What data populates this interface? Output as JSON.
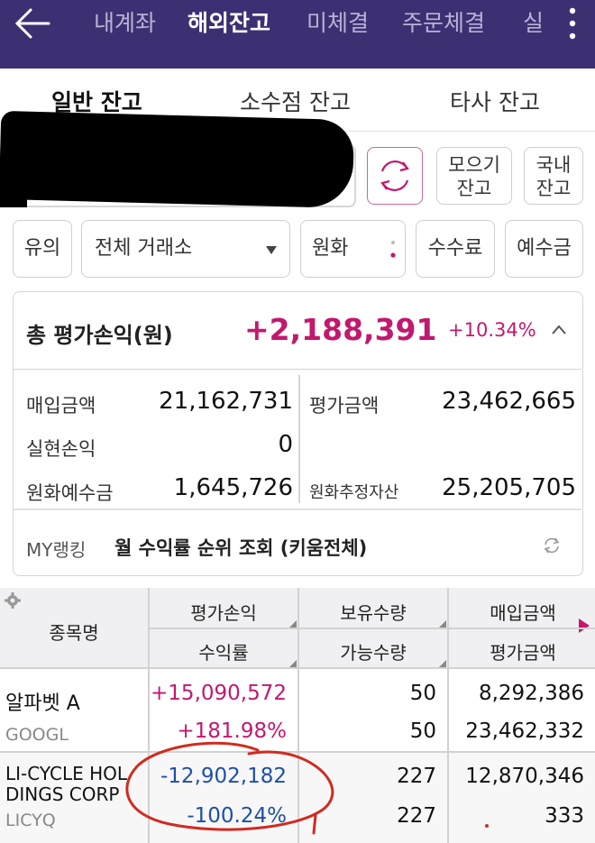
{
  "nav": {
    "items": [
      "내계좌",
      "해외잔고",
      "미체결",
      "주문체결",
      "실"
    ],
    "active_index": 1
  },
  "tabs": [
    "일반 잔고",
    "소수점 잔고",
    "타사 잔고"
  ],
  "buttons": {
    "gather": [
      "모으기",
      "잔고"
    ],
    "domestic": [
      "국내",
      "잔고"
    ],
    "caution": "유의",
    "exchange": "전체 거래소",
    "currency": "원화",
    "fee": "수수료",
    "deposit": "예수금"
  },
  "summary": {
    "label": "총 평가손익(원)",
    "value": "+2,188,391",
    "rate": "+10.34%",
    "purchase_label": "매입금액",
    "purchase_value": "21,162,731",
    "eval_label": "평가금액",
    "eval_value": "23,462,665",
    "realized_label": "실현손익",
    "realized_value": "0",
    "krw_deposit_label": "원화예수금",
    "krw_deposit_value": "1,645,726",
    "krw_assets_label": "원화추정자산",
    "krw_assets_value": "25,205,705",
    "ranking_label": "MY랭킹",
    "ranking_text": "월 수익률 순위 조회 (키움전체)"
  },
  "table": {
    "headers": {
      "name": "종목명",
      "pl": "평가손익",
      "rate": "수익률",
      "qty": "보유수량",
      "avail": "가능수량",
      "purchase": "매입금액",
      "eval": "평가금액"
    },
    "rows": [
      {
        "name": "알파벳 A",
        "ticker": "GOOGL",
        "pl": "+15,090,572",
        "rate": "+181.98%",
        "qty": "50",
        "avail": "50",
        "purchase": "8,292,386",
        "eval": "23,462,332"
      },
      {
        "name_line1": "LI-CYCLE HOL",
        "name_line2": "DINGS CORP",
        "ticker": "LICYQ",
        "pl": "-12,902,182",
        "rate": "-100.24%",
        "qty": "227",
        "avail": "227",
        "purchase": "12,870,346",
        "eval": "333"
      }
    ]
  },
  "colors": {
    "header_bg": "#3e2f72",
    "positive": "#c2186e",
    "negative": "#1f4fa6",
    "annotation": "#d22a1e"
  }
}
